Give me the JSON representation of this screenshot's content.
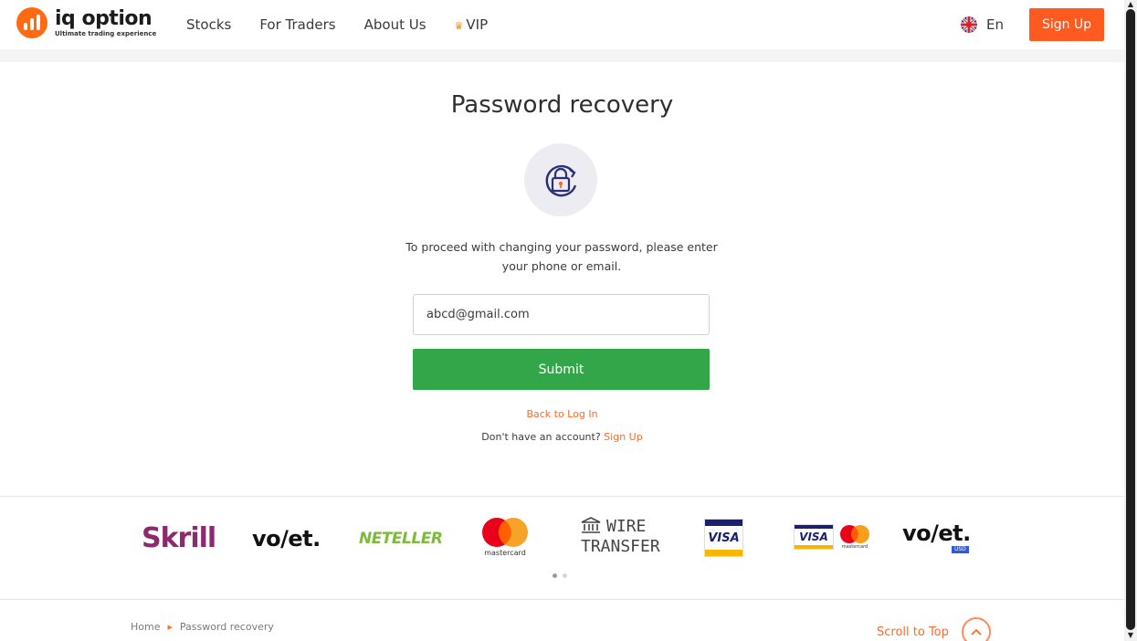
{
  "header": {
    "logo": {
      "name": "iq option",
      "tagline": "Ultimate trading experience",
      "icon": "bar-chart-logo-icon"
    },
    "nav": [
      {
        "label": "Stocks"
      },
      {
        "label": "For Traders"
      },
      {
        "label": "About Us"
      },
      {
        "label": "VIP",
        "icon": "crown-icon"
      }
    ],
    "language": {
      "label": "En",
      "icon": "uk-flag-icon"
    },
    "signup_label": "Sign Up"
  },
  "main": {
    "title": "Password recovery",
    "icon": "lock-refresh-icon",
    "instructions": "To proceed with changing your password, please enter your phone or email.",
    "email_value": "abcd@gmail.com",
    "submit_label": "Submit",
    "back_link": "Back to Log In",
    "no_account_text": "Don't have an account?",
    "signup_link": "Sign Up"
  },
  "payments": {
    "skrill": "Skrill",
    "volet": "vo/et.",
    "neteller": "NETELLER",
    "mastercard": "mastercard",
    "wire_line1": "WIRE",
    "wire_line2": "TRANSFER",
    "visa": "VISA",
    "visa2": "VISA",
    "mastercard2": "mastercard",
    "volet2": "vo/et.",
    "volet2_badge": "USD"
  },
  "footer": {
    "breadcrumb_home": "Home",
    "breadcrumb_current": "Password recovery",
    "scroll_top_label": "Scroll to Top"
  },
  "colors": {
    "accent": "#ff5a1f",
    "submit": "#33a64a",
    "link": "#ff6a2a"
  }
}
